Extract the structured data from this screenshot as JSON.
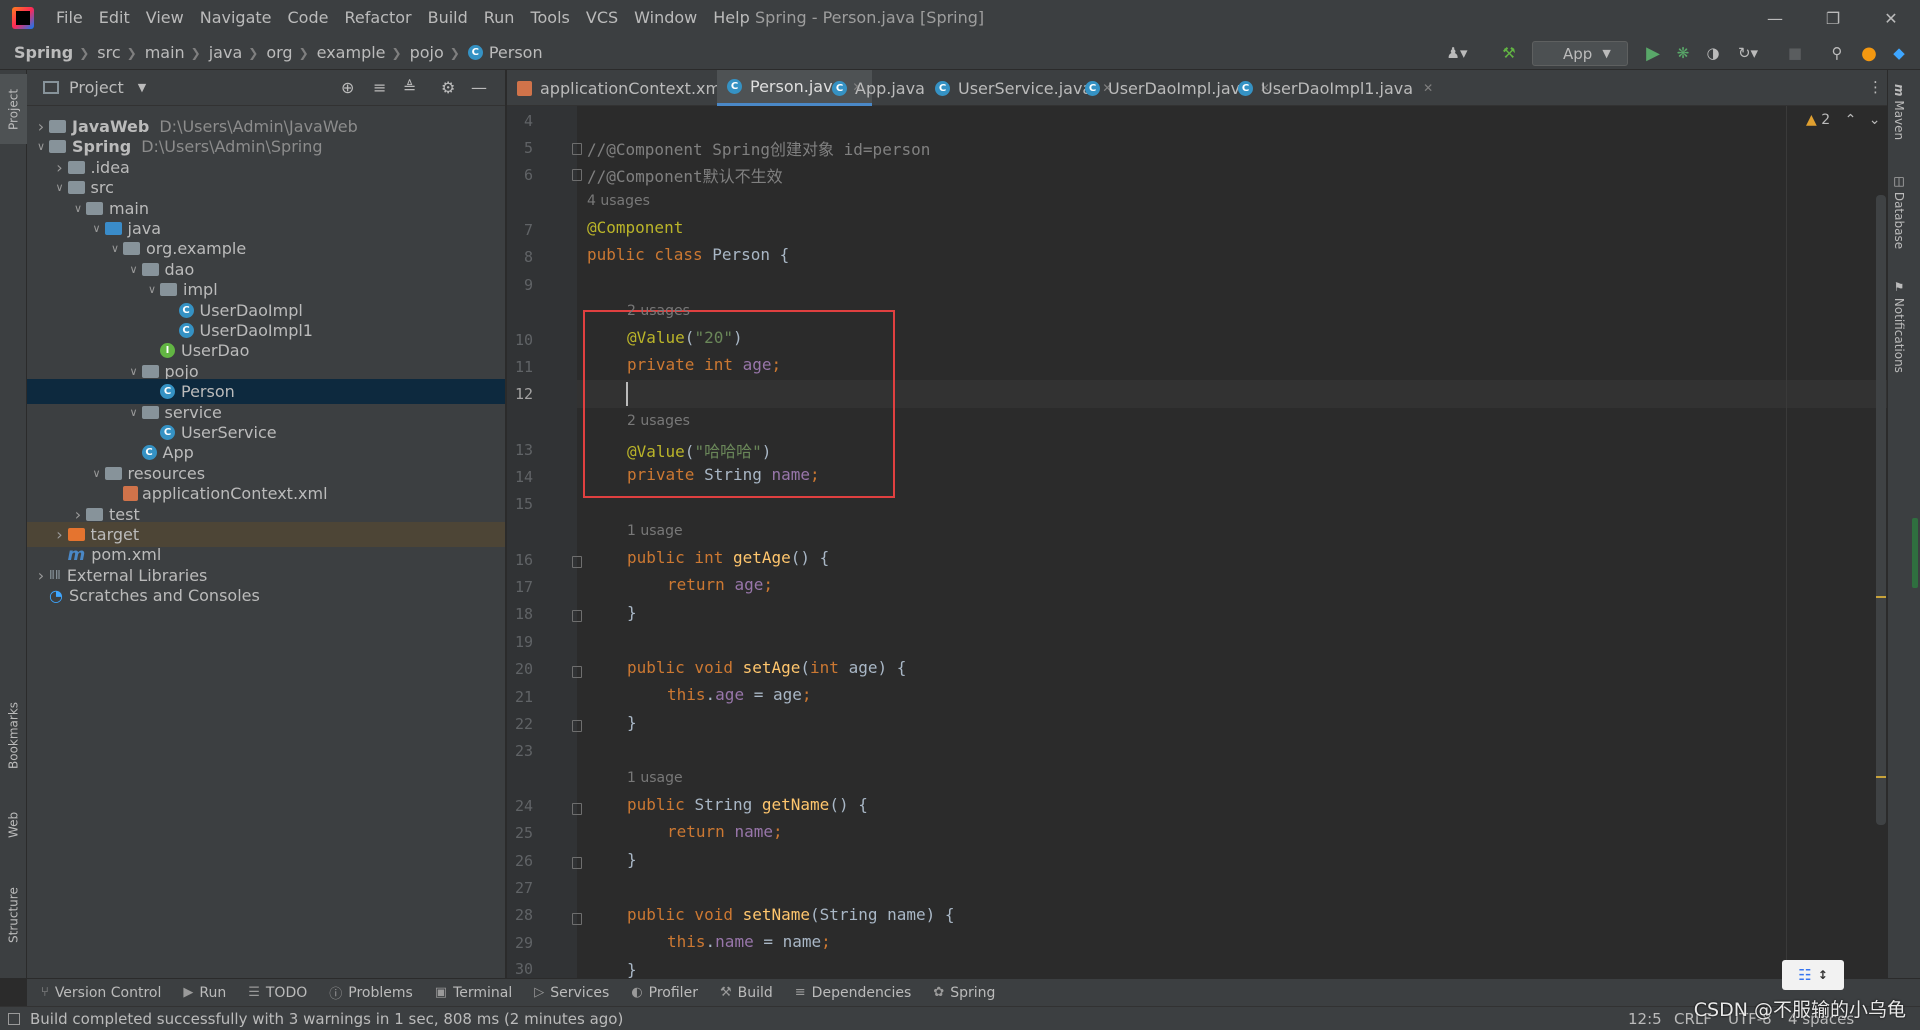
{
  "window": {
    "title": "Spring - Person.java [Spring]",
    "menu": [
      "File",
      "Edit",
      "View",
      "Navigate",
      "Code",
      "Refactor",
      "Build",
      "Run",
      "Tools",
      "VCS",
      "Window",
      "Help"
    ]
  },
  "breadcrumb": [
    "Spring",
    "src",
    "main",
    "java",
    "org",
    "example",
    "pojo",
    "Person"
  ],
  "run_config": "App",
  "project_panel": {
    "title": "Project",
    "tree": [
      {
        "label": "JavaWeb",
        "path": "D:\\Users\\Admin\\JavaWeb",
        "depth": 0,
        "icon": "module-folder-icon",
        "expanded": false,
        "bold": true
      },
      {
        "label": "Spring",
        "path": "D:\\Users\\Admin\\Spring",
        "depth": 0,
        "icon": "module-folder-icon",
        "expanded": true,
        "bold": true
      },
      {
        "label": ".idea",
        "depth": 1,
        "icon": "folder-icon",
        "expanded": false
      },
      {
        "label": "src",
        "depth": 1,
        "icon": "folder-icon",
        "expanded": true
      },
      {
        "label": "main",
        "depth": 2,
        "icon": "folder-icon",
        "expanded": true
      },
      {
        "label": "java",
        "depth": 3,
        "icon": "source-folder-icon",
        "expanded": true
      },
      {
        "label": "org.example",
        "depth": 4,
        "icon": "package-icon",
        "expanded": true
      },
      {
        "label": "dao",
        "depth": 5,
        "icon": "package-icon",
        "expanded": true
      },
      {
        "label": "impl",
        "depth": 6,
        "icon": "package-icon",
        "expanded": true
      },
      {
        "label": "UserDaoImpl",
        "depth": 7,
        "icon": "class-icon"
      },
      {
        "label": "UserDaoImpl1",
        "depth": 7,
        "icon": "class-icon"
      },
      {
        "label": "UserDao",
        "depth": 6,
        "icon": "interface-icon"
      },
      {
        "label": "pojo",
        "depth": 5,
        "icon": "package-icon",
        "expanded": true
      },
      {
        "label": "Person",
        "depth": 6,
        "icon": "class-icon",
        "selected": true
      },
      {
        "label": "service",
        "depth": 5,
        "icon": "package-icon",
        "expanded": true
      },
      {
        "label": "UserService",
        "depth": 6,
        "icon": "class-icon"
      },
      {
        "label": "App",
        "depth": 5,
        "icon": "class-icon"
      },
      {
        "label": "resources",
        "depth": 3,
        "icon": "resources-folder-icon",
        "expanded": true
      },
      {
        "label": "applicationContext.xml",
        "depth": 4,
        "icon": "xml-file-icon"
      },
      {
        "label": "test",
        "depth": 2,
        "icon": "folder-icon",
        "expanded": false
      },
      {
        "label": "target",
        "depth": 1,
        "icon": "excluded-folder-icon",
        "expanded": false,
        "highlight": true
      },
      {
        "label": "pom.xml",
        "depth": 1,
        "icon": "maven-icon"
      },
      {
        "label": "External Libraries",
        "depth": 0,
        "icon": "library-icon",
        "expanded": false
      },
      {
        "label": "Scratches and Consoles",
        "depth": 0,
        "icon": "scratch-icon"
      }
    ]
  },
  "tabs": [
    {
      "label": "applicationContext.xml",
      "icon": "xml-file-icon"
    },
    {
      "label": "Person.java",
      "icon": "class-icon",
      "active": true
    },
    {
      "label": "App.java",
      "icon": "class-icon"
    },
    {
      "label": "UserService.java",
      "icon": "class-icon"
    },
    {
      "label": "UserDaoImpl.java",
      "icon": "class-icon"
    },
    {
      "label": "UserDaoImpl1.java",
      "icon": "class-icon"
    }
  ],
  "editor": {
    "warnings": "2",
    "line_numbers": [
      "4",
      "5",
      "6",
      "7",
      "8",
      "9",
      "10",
      "11",
      "12",
      "13",
      "14",
      "15",
      "16",
      "17",
      "18",
      "19",
      "20",
      "21",
      "22",
      "23",
      "24",
      "25",
      "26",
      "27",
      "28",
      "29",
      "30"
    ],
    "current_line": "12",
    "hints": {
      "person_usages": "4 usages",
      "age_usages": "2 usages",
      "name_usages": "2 usages",
      "getage_usages": "1 usage",
      "getname_usages": "1 usage"
    },
    "code": {
      "c1": "//@Component Spring创建对象 id=person",
      "c2": "//@Component默认不生效",
      "ann_component": "@Component",
      "kw_public_class": "public class ",
      "class_name": "Person {",
      "ann_value": "@Value",
      "age_value": "\"20\"",
      "kw_private_int": "private int ",
      "fld_age": "age",
      "name_value": "\"哈哈哈\"",
      "kw_private": "private ",
      "type_string": "String ",
      "fld_name": "name",
      "kw_public_int": "public int ",
      "m_getage": "getAge",
      "kw_return": "return ",
      "kw_public_void": "public void ",
      "m_setage": "setAge",
      "kw_int": "int ",
      "param_age": "age) {",
      "kw_this": "this",
      "kw_public": "public ",
      "m_getname": "getName",
      "m_setname": "setName",
      "param_name": "String name) {"
    }
  },
  "bottom_tools": [
    "Version Control",
    "Run",
    "TODO",
    "Problems",
    "Terminal",
    "Services",
    "Profiler",
    "Build",
    "Dependencies",
    "Spring"
  ],
  "status": {
    "message": "Build completed successfully with 3 warnings in 1 sec, 808 ms (2 minutes ago)",
    "position": "12:5",
    "line_sep": "CRLF",
    "encoding": "UTF-8",
    "indent": "4 spaces"
  },
  "left_strip": [
    "Project",
    "Bookmarks",
    "Web",
    "Structure"
  ],
  "right_strip": [
    "Maven",
    "Database",
    "Notifications"
  ],
  "watermark": "CSDN @不服输的小乌龟",
  "colors": {
    "accent": "#4a88c7",
    "keyword": "#cc7832",
    "annotation": "#bbb529",
    "string": "#6a8759",
    "field": "#9876aa",
    "method": "#ffc66d",
    "highlight_box": "#e04040"
  }
}
